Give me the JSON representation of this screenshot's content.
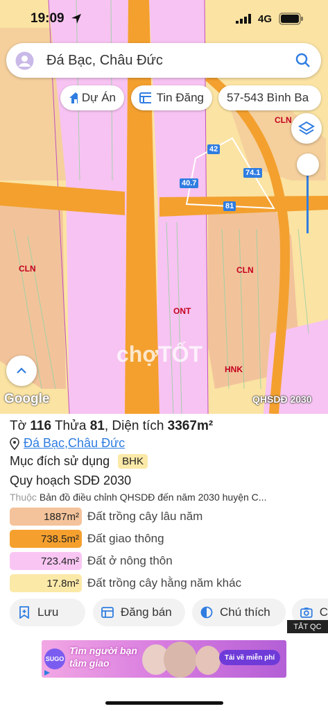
{
  "status": {
    "time": "19:09",
    "network": "4G"
  },
  "search": {
    "query": "Đá Bạc, Châu Đức"
  },
  "chips": [
    {
      "label": "Dự Án",
      "icon": "house-icon"
    },
    {
      "label": "Tin Đăng",
      "icon": "listing-icon"
    },
    {
      "label": "57-543 Bình Ba",
      "icon": ""
    }
  ],
  "map": {
    "labels": [
      "CLN",
      "CLN",
      "CLN",
      "ONT",
      "HNK"
    ],
    "dimensions": [
      "42",
      "74.1",
      "40.7",
      "81"
    ],
    "watermark": "chợTỐT",
    "google_logo": "Google",
    "layer_badge": "QHSDĐ 2030"
  },
  "info": {
    "to_label": "Tờ",
    "to_value": "116",
    "thua_label": "Thửa",
    "thua_value": "81",
    "area_label": "Diện tích",
    "area_value": "3367m²",
    "location_ward": "Đá Bạc",
    "location_sep": ", ",
    "location_district": "Châu Đức",
    "purpose_label": "Mục đích sử dụng",
    "purpose_value": "BHK",
    "plan_title": "Quy hoạch SDĐ 2030",
    "belongs_label": "Thuộc",
    "belongs_value": "Bản đồ điều chỉnh QHSDĐ đến năm 2030 huyện C..."
  },
  "legend": [
    {
      "area": "1887m²",
      "name": "Đất trồng cây lâu năm",
      "color": "#f4c39b"
    },
    {
      "area": "738.5m²",
      "name": "Đất giao thông",
      "color": "#f5a02e"
    },
    {
      "area": "723.4m²",
      "name": "Đất ở nông thôn",
      "color": "#f9c6f3"
    },
    {
      "area": "17.8m²",
      "name": "Đất trồng cây hằng năm khác",
      "color": "#fbe9a8"
    }
  ],
  "actions": [
    {
      "label": "Lưu"
    },
    {
      "label": "Đăng bán"
    },
    {
      "label": "Chú thích"
    },
    {
      "label": "C"
    }
  ],
  "ad": {
    "close_label": "TẮT QC",
    "headline": "Tìm người bạn tâm giao",
    "cta": "Tải về miễn phí",
    "brand": "SUGO"
  }
}
